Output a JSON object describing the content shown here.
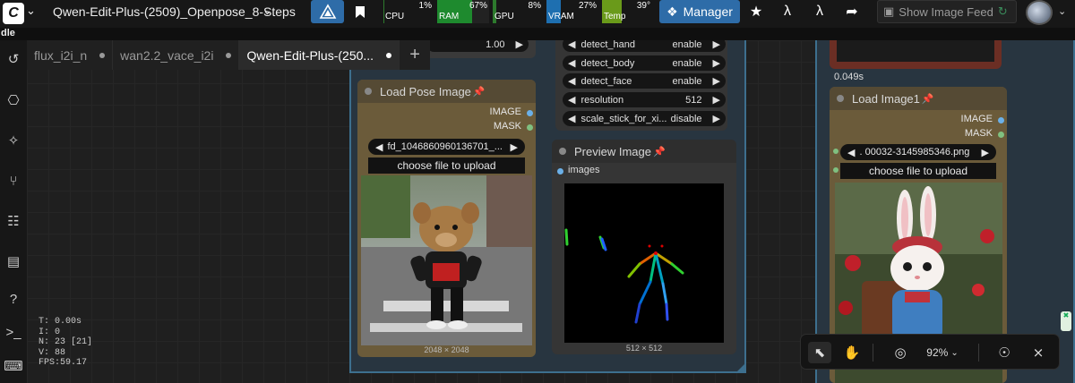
{
  "topbar": {
    "logo": "C",
    "workflow_title": "Qwen-Edit-Plus-(2509)_Openpose_8-Steps",
    "stats": [
      {
        "label": "CPU",
        "value": "1%",
        "level": 0.01,
        "color": "#2d7a2d"
      },
      {
        "label": "RAM",
        "value": "67%",
        "level": 0.67,
        "color": "#1e8a2e"
      },
      {
        "label": "GPU",
        "value": "8%",
        "level": 0.08,
        "color": "#2d7a2d"
      },
      {
        "label": "VRAM",
        "value": "27%",
        "level": 0.27,
        "color": "#1e6fb0"
      },
      {
        "label": "Temp",
        "value": "39°",
        "level": 0.39,
        "color": "#6a9a1a"
      }
    ],
    "manager_label": "Manager",
    "show_feed_label": "Show Image Feed"
  },
  "subbar_text": "dle",
  "tabs": [
    {
      "label": "flux_i2i_n"
    },
    {
      "label": "wan2.2_vace_i2i"
    },
    {
      "label": "Qwen-Edit-Plus-(250..."
    }
  ],
  "nodes": {
    "strength_value": "1.00",
    "dwpose_widgets": [
      {
        "name": "detect_hand",
        "value": "enable"
      },
      {
        "name": "detect_body",
        "value": "enable"
      },
      {
        "name": "detect_face",
        "value": "enable"
      },
      {
        "name": "resolution",
        "value": "512"
      },
      {
        "name": "scale_stick_for_xi...",
        "value": "disable"
      }
    ],
    "load_pose": {
      "title": "Load Pose Image",
      "outputs": [
        "IMAGE",
        "MASK"
      ],
      "file": "fd_1046860960136701_...",
      "upload_label": "choose file to upload",
      "image_dims": "2048 × 2048"
    },
    "preview": {
      "title": "Preview Image",
      "input": "images",
      "image_dims": "512 × 512"
    },
    "load_image1": {
      "title": "Load Image1",
      "time": "0.049s",
      "outputs": [
        "IMAGE",
        "MASK"
      ],
      "file": ". 00032-3145985346.png",
      "upload_label": "choose file to upload"
    }
  },
  "stats_overlay": [
    "T: 0.00s",
    "I: 0",
    "N: 23 [21]",
    "V: 88",
    "FPS:59.17"
  ],
  "toolbar": {
    "zoom": "92%"
  }
}
